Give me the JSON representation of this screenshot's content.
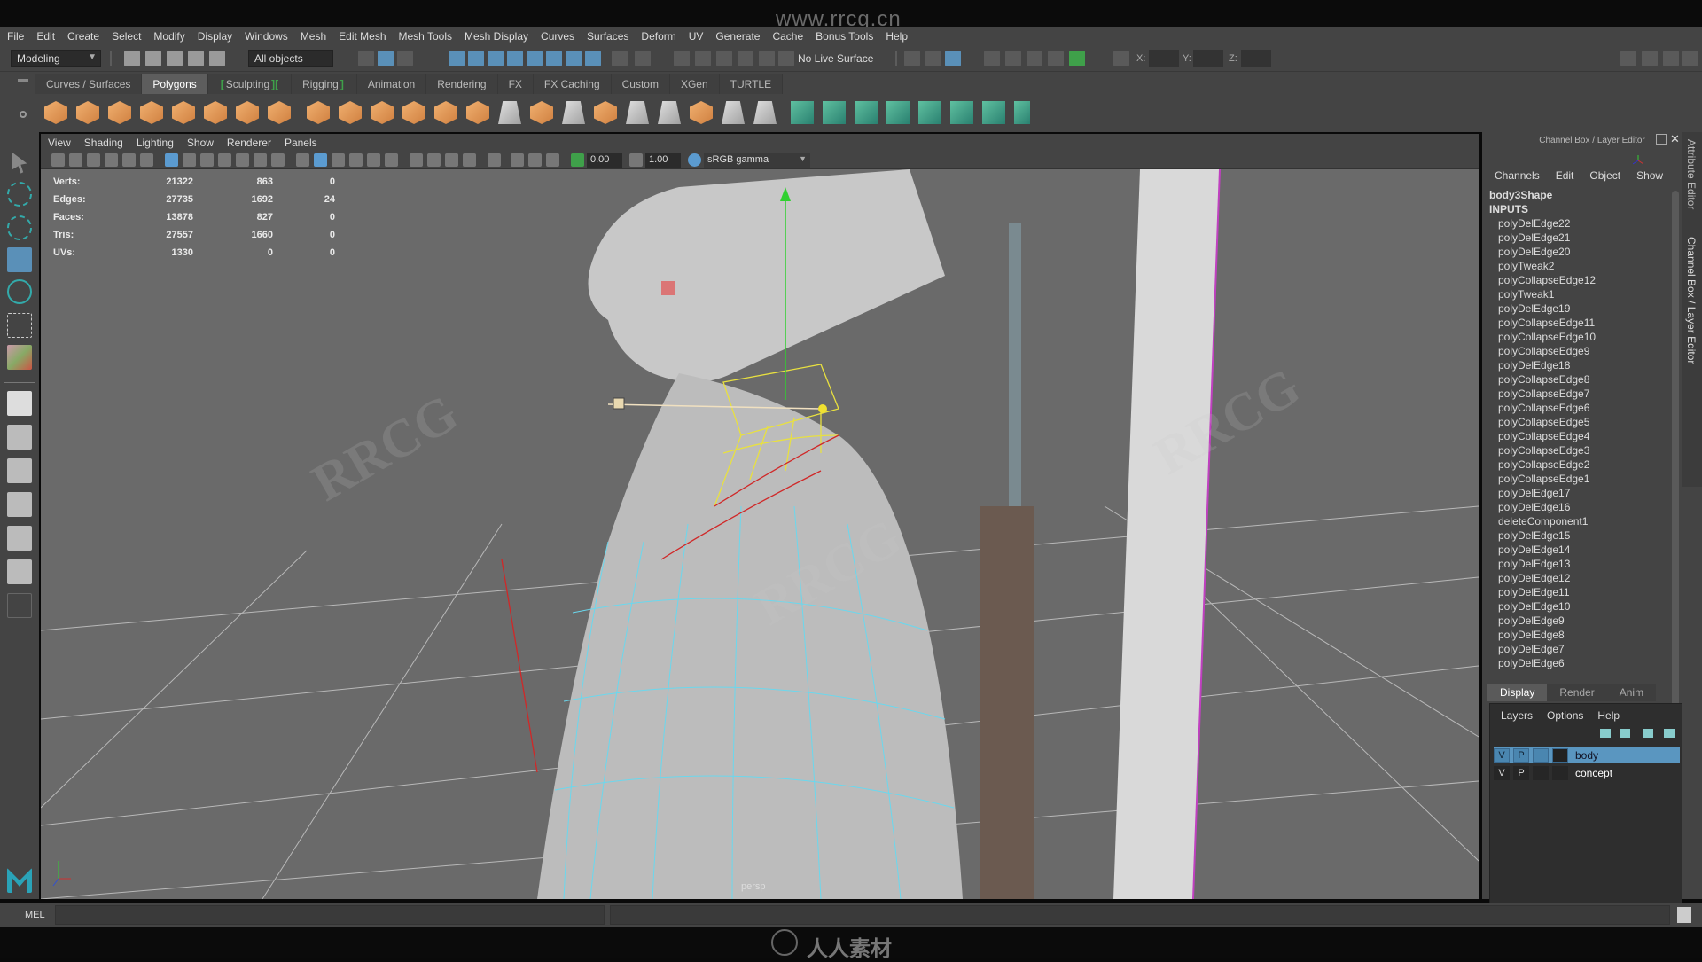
{
  "watermark": {
    "url": "www.rrcg.cn",
    "brand": "RRCG",
    "footer": "人人素材"
  },
  "menubar": [
    "File",
    "Edit",
    "Create",
    "Select",
    "Modify",
    "Display",
    "Windows",
    "Mesh",
    "Edit Mesh",
    "Mesh Tools",
    "Mesh Display",
    "Curves",
    "Surfaces",
    "Deform",
    "UV",
    "Generate",
    "Cache",
    "Bonus Tools",
    "Help"
  ],
  "statusline": {
    "workspace": "Modeling",
    "selection_mask": "All objects",
    "live_surface": "No Live Surface",
    "x_label": "X:",
    "y_label": "Y:",
    "z_label": "Z:"
  },
  "shelf": {
    "tabs": [
      "Curves / Surfaces",
      "Polygons",
      "Sculpting",
      "Rigging",
      "Animation",
      "Rendering",
      "FX",
      "FX Caching",
      "Custom",
      "XGen",
      "TURTLE"
    ],
    "active_tab": "Polygons"
  },
  "viewport": {
    "menu": [
      "View",
      "Shading",
      "Lighting",
      "Show",
      "Renderer",
      "Panels"
    ],
    "exposure": "0.00",
    "gamma": "1.00",
    "color_space": "sRGB gamma",
    "camera": "persp",
    "hud": [
      {
        "label": "Verts:",
        "total": "21322",
        "selected": "863",
        "extra": "0"
      },
      {
        "label": "Edges:",
        "total": "27735",
        "selected": "1692",
        "extra": "24"
      },
      {
        "label": "Faces:",
        "total": "13878",
        "selected": "827",
        "extra": "0"
      },
      {
        "label": "Tris:",
        "total": "27557",
        "selected": "1660",
        "extra": "0"
      },
      {
        "label": "UVs:",
        "total": "1330",
        "selected": "0",
        "extra": "0"
      }
    ]
  },
  "channel_box": {
    "title": "Channel Box / Layer Editor",
    "menu": [
      "Channels",
      "Edit",
      "Object",
      "Show"
    ],
    "object": "body3Shape",
    "inputs_label": "INPUTS",
    "inputs": [
      "polyDelEdge22",
      "polyDelEdge21",
      "polyDelEdge20",
      "polyTweak2",
      "polyCollapseEdge12",
      "polyTweak1",
      "polyDelEdge19",
      "polyCollapseEdge11",
      "polyCollapseEdge10",
      "polyCollapseEdge9",
      "polyDelEdge18",
      "polyCollapseEdge8",
      "polyCollapseEdge7",
      "polyCollapseEdge6",
      "polyCollapseEdge5",
      "polyCollapseEdge4",
      "polyCollapseEdge3",
      "polyCollapseEdge2",
      "polyCollapseEdge1",
      "polyDelEdge17",
      "polyDelEdge16",
      "deleteComponent1",
      "polyDelEdge15",
      "polyDelEdge14",
      "polyDelEdge13",
      "polyDelEdge12",
      "polyDelEdge11",
      "polyDelEdge10",
      "polyDelEdge9",
      "polyDelEdge8",
      "polyDelEdge7",
      "polyDelEdge6"
    ],
    "side_tabs": [
      "Attribute Editor",
      "Channel Box / Layer Editor"
    ]
  },
  "layer_editor": {
    "tabs": [
      "Display",
      "Render",
      "Anim"
    ],
    "active_tab": "Display",
    "menu": [
      "Layers",
      "Options",
      "Help"
    ],
    "layers": [
      {
        "v": "V",
        "p": "P",
        "name": "body",
        "selected": true
      },
      {
        "v": "V",
        "p": "P",
        "name": "concept",
        "selected": false
      }
    ]
  },
  "command_line": {
    "language": "MEL"
  }
}
